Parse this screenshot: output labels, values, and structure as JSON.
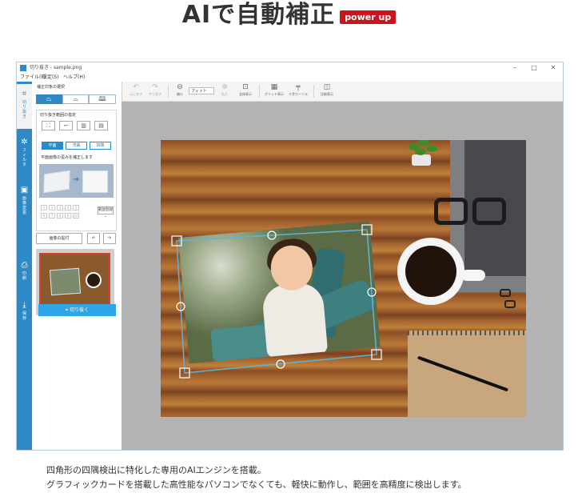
{
  "headline": {
    "title": "AIで自動補正",
    "badge": "power up"
  },
  "app": {
    "title": "切り抜き - sample.png",
    "menu": [
      "ファイル(F)",
      "設定(S)",
      "ヘルプ(H)"
    ],
    "window_controls": [
      "–",
      "□",
      "✕"
    ]
  },
  "toolbar": {
    "items": [
      {
        "icon": "undo-icon",
        "label": "元に戻す",
        "glyph": "↶",
        "enabled": false
      },
      {
        "icon": "redo-icon",
        "label": "やり直す",
        "glyph": "↷",
        "enabled": false
      },
      {
        "icon": "zoom-out-icon",
        "label": "縮小",
        "glyph": "⊖",
        "enabled": true
      },
      {
        "icon": "zoom-in-icon",
        "label": "拡大",
        "glyph": "⊕",
        "enabled": false
      },
      {
        "icon": "fit-all-icon",
        "label": "全体表示",
        "glyph": "⊡",
        "enabled": true
      },
      {
        "icon": "grid-icon",
        "label": "グリッド表示",
        "glyph": "▦",
        "enabled": true
      },
      {
        "icon": "cursor-icon",
        "label": "十字カーソル",
        "glyph": "╤",
        "enabled": true
      },
      {
        "icon": "compare-icon",
        "label": "比較表示",
        "glyph": "◫",
        "enabled": true
      }
    ],
    "zoom_value": "フィット"
  },
  "sidebar": {
    "items": [
      {
        "icon": "crop-icon",
        "glyph": "⌗",
        "label": "切り抜き",
        "active": true
      },
      {
        "icon": "filter-icon",
        "glyph": "✲",
        "label": "フィルタ",
        "active": false
      },
      {
        "icon": "image-settings-icon",
        "glyph": "▣",
        "label": "画像変更",
        "active": false
      },
      {
        "icon": "print-icon",
        "glyph": "⎙",
        "label": "印刷",
        "active": false
      },
      {
        "icon": "save-icon",
        "glyph": "⤓",
        "label": "保存",
        "active": false
      }
    ]
  },
  "panel": {
    "target_label": "補正対象の選択",
    "range_label": "切り抜き範囲の指定",
    "faces": [
      "平面",
      "湾曲",
      "四隅"
    ],
    "hint": "平面画像の歪みを補正します",
    "numbers": [
      "1",
      "2",
      "3",
      "4",
      "5",
      "6",
      "7",
      "8",
      "9",
      "10"
    ],
    "register": "範囲登録 ⌄",
    "paste_label": "画像の貼付",
    "cut_button": "切り抜く"
  },
  "description": {
    "line1": "四角形の四隅検出に特化した専用のAIエンジンを搭載。",
    "line2": "グラフィックカードを搭載した高性能なパソコンでなくても、軽快に動作し、範囲を高精度に検出します。"
  },
  "colors": {
    "accent": "#2d8ac7",
    "badge": "#c8161d",
    "button": "#2ea5e6"
  }
}
